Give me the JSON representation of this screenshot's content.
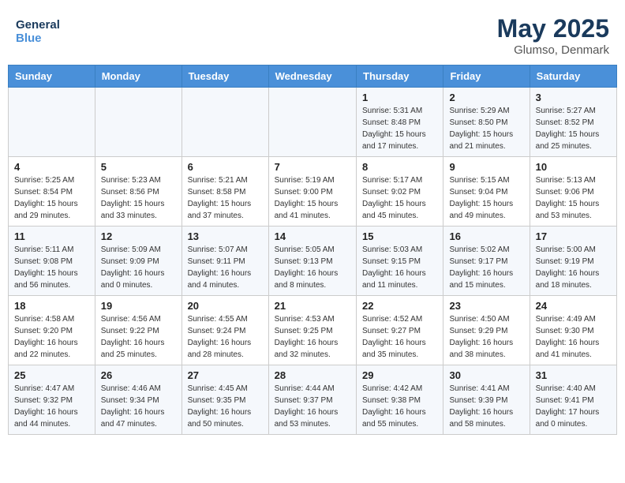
{
  "logo": {
    "line1": "General",
    "line2": "Blue"
  },
  "title": "May 2025",
  "location": "Glumso, Denmark",
  "weekdays": [
    "Sunday",
    "Monday",
    "Tuesday",
    "Wednesday",
    "Thursday",
    "Friday",
    "Saturday"
  ],
  "weeks": [
    [
      {
        "day": "",
        "info": ""
      },
      {
        "day": "",
        "info": ""
      },
      {
        "day": "",
        "info": ""
      },
      {
        "day": "",
        "info": ""
      },
      {
        "day": "1",
        "info": "Sunrise: 5:31 AM\nSunset: 8:48 PM\nDaylight: 15 hours\nand 17 minutes."
      },
      {
        "day": "2",
        "info": "Sunrise: 5:29 AM\nSunset: 8:50 PM\nDaylight: 15 hours\nand 21 minutes."
      },
      {
        "day": "3",
        "info": "Sunrise: 5:27 AM\nSunset: 8:52 PM\nDaylight: 15 hours\nand 25 minutes."
      }
    ],
    [
      {
        "day": "4",
        "info": "Sunrise: 5:25 AM\nSunset: 8:54 PM\nDaylight: 15 hours\nand 29 minutes."
      },
      {
        "day": "5",
        "info": "Sunrise: 5:23 AM\nSunset: 8:56 PM\nDaylight: 15 hours\nand 33 minutes."
      },
      {
        "day": "6",
        "info": "Sunrise: 5:21 AM\nSunset: 8:58 PM\nDaylight: 15 hours\nand 37 minutes."
      },
      {
        "day": "7",
        "info": "Sunrise: 5:19 AM\nSunset: 9:00 PM\nDaylight: 15 hours\nand 41 minutes."
      },
      {
        "day": "8",
        "info": "Sunrise: 5:17 AM\nSunset: 9:02 PM\nDaylight: 15 hours\nand 45 minutes."
      },
      {
        "day": "9",
        "info": "Sunrise: 5:15 AM\nSunset: 9:04 PM\nDaylight: 15 hours\nand 49 minutes."
      },
      {
        "day": "10",
        "info": "Sunrise: 5:13 AM\nSunset: 9:06 PM\nDaylight: 15 hours\nand 53 minutes."
      }
    ],
    [
      {
        "day": "11",
        "info": "Sunrise: 5:11 AM\nSunset: 9:08 PM\nDaylight: 15 hours\nand 56 minutes."
      },
      {
        "day": "12",
        "info": "Sunrise: 5:09 AM\nSunset: 9:09 PM\nDaylight: 16 hours\nand 0 minutes."
      },
      {
        "day": "13",
        "info": "Sunrise: 5:07 AM\nSunset: 9:11 PM\nDaylight: 16 hours\nand 4 minutes."
      },
      {
        "day": "14",
        "info": "Sunrise: 5:05 AM\nSunset: 9:13 PM\nDaylight: 16 hours\nand 8 minutes."
      },
      {
        "day": "15",
        "info": "Sunrise: 5:03 AM\nSunset: 9:15 PM\nDaylight: 16 hours\nand 11 minutes."
      },
      {
        "day": "16",
        "info": "Sunrise: 5:02 AM\nSunset: 9:17 PM\nDaylight: 16 hours\nand 15 minutes."
      },
      {
        "day": "17",
        "info": "Sunrise: 5:00 AM\nSunset: 9:19 PM\nDaylight: 16 hours\nand 18 minutes."
      }
    ],
    [
      {
        "day": "18",
        "info": "Sunrise: 4:58 AM\nSunset: 9:20 PM\nDaylight: 16 hours\nand 22 minutes."
      },
      {
        "day": "19",
        "info": "Sunrise: 4:56 AM\nSunset: 9:22 PM\nDaylight: 16 hours\nand 25 minutes."
      },
      {
        "day": "20",
        "info": "Sunrise: 4:55 AM\nSunset: 9:24 PM\nDaylight: 16 hours\nand 28 minutes."
      },
      {
        "day": "21",
        "info": "Sunrise: 4:53 AM\nSunset: 9:25 PM\nDaylight: 16 hours\nand 32 minutes."
      },
      {
        "day": "22",
        "info": "Sunrise: 4:52 AM\nSunset: 9:27 PM\nDaylight: 16 hours\nand 35 minutes."
      },
      {
        "day": "23",
        "info": "Sunrise: 4:50 AM\nSunset: 9:29 PM\nDaylight: 16 hours\nand 38 minutes."
      },
      {
        "day": "24",
        "info": "Sunrise: 4:49 AM\nSunset: 9:30 PM\nDaylight: 16 hours\nand 41 minutes."
      }
    ],
    [
      {
        "day": "25",
        "info": "Sunrise: 4:47 AM\nSunset: 9:32 PM\nDaylight: 16 hours\nand 44 minutes."
      },
      {
        "day": "26",
        "info": "Sunrise: 4:46 AM\nSunset: 9:34 PM\nDaylight: 16 hours\nand 47 minutes."
      },
      {
        "day": "27",
        "info": "Sunrise: 4:45 AM\nSunset: 9:35 PM\nDaylight: 16 hours\nand 50 minutes."
      },
      {
        "day": "28",
        "info": "Sunrise: 4:44 AM\nSunset: 9:37 PM\nDaylight: 16 hours\nand 53 minutes."
      },
      {
        "day": "29",
        "info": "Sunrise: 4:42 AM\nSunset: 9:38 PM\nDaylight: 16 hours\nand 55 minutes."
      },
      {
        "day": "30",
        "info": "Sunrise: 4:41 AM\nSunset: 9:39 PM\nDaylight: 16 hours\nand 58 minutes."
      },
      {
        "day": "31",
        "info": "Sunrise: 4:40 AM\nSunset: 9:41 PM\nDaylight: 17 hours\nand 0 minutes."
      }
    ]
  ]
}
